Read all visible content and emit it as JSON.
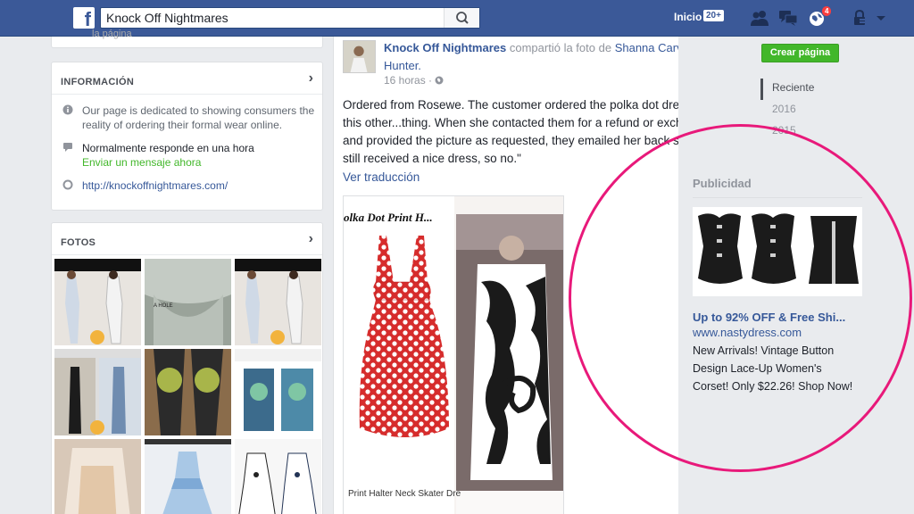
{
  "topbar": {
    "search_value": "Knock Off Nightmares",
    "home_label": "Inicio",
    "home_count": "20+",
    "notification_count": "4"
  },
  "info": {
    "stub_text": "la página",
    "title": "INFORMACIÓN",
    "description": "Our page is dedicated to showing consumers the reality of ordering their formal wear online.",
    "response_time": "Normalmente responde en una hora",
    "send_message": "Enviar un mensaje ahora",
    "website": "http://knockoffnightmares.com/"
  },
  "photos": {
    "title": "FOTOS",
    "hole_label": "A HOLE"
  },
  "post": {
    "page_name": "Knock Off Nightmares",
    "shared_text": "compartió la foto de",
    "person": "Shanna Carver Hunter.",
    "time": "16 horas · ",
    "text": "Ordered from Rosewe. The customer ordered the polka dot dress and got this other...thing. When she contacted them for a refund or exchange, and provided the picture as requested, they emailed her back saying you still received a nice dress, so no.\"",
    "translate": "Ver traducción",
    "photo_title": "olka Dot Print H...",
    "photo_caption": "Print Halter Neck Skater Dre"
  },
  "sidebar": {
    "create_page": "Crear página",
    "years": [
      "Reciente",
      "2016",
      "2015"
    ]
  },
  "ad": {
    "heading": "Publicidad",
    "title": "Up to 92% OFF & Free Shi...",
    "url": "www.nastydress.com",
    "body": "New Arrivals! Vintage Button Design Lace-Up Women's Corset! Only $22.26! Shop Now!"
  },
  "colors": {
    "topbar": "#3b5998",
    "link": "#365899",
    "green": "#42b72a",
    "highlight_circle": "#e8197a"
  }
}
